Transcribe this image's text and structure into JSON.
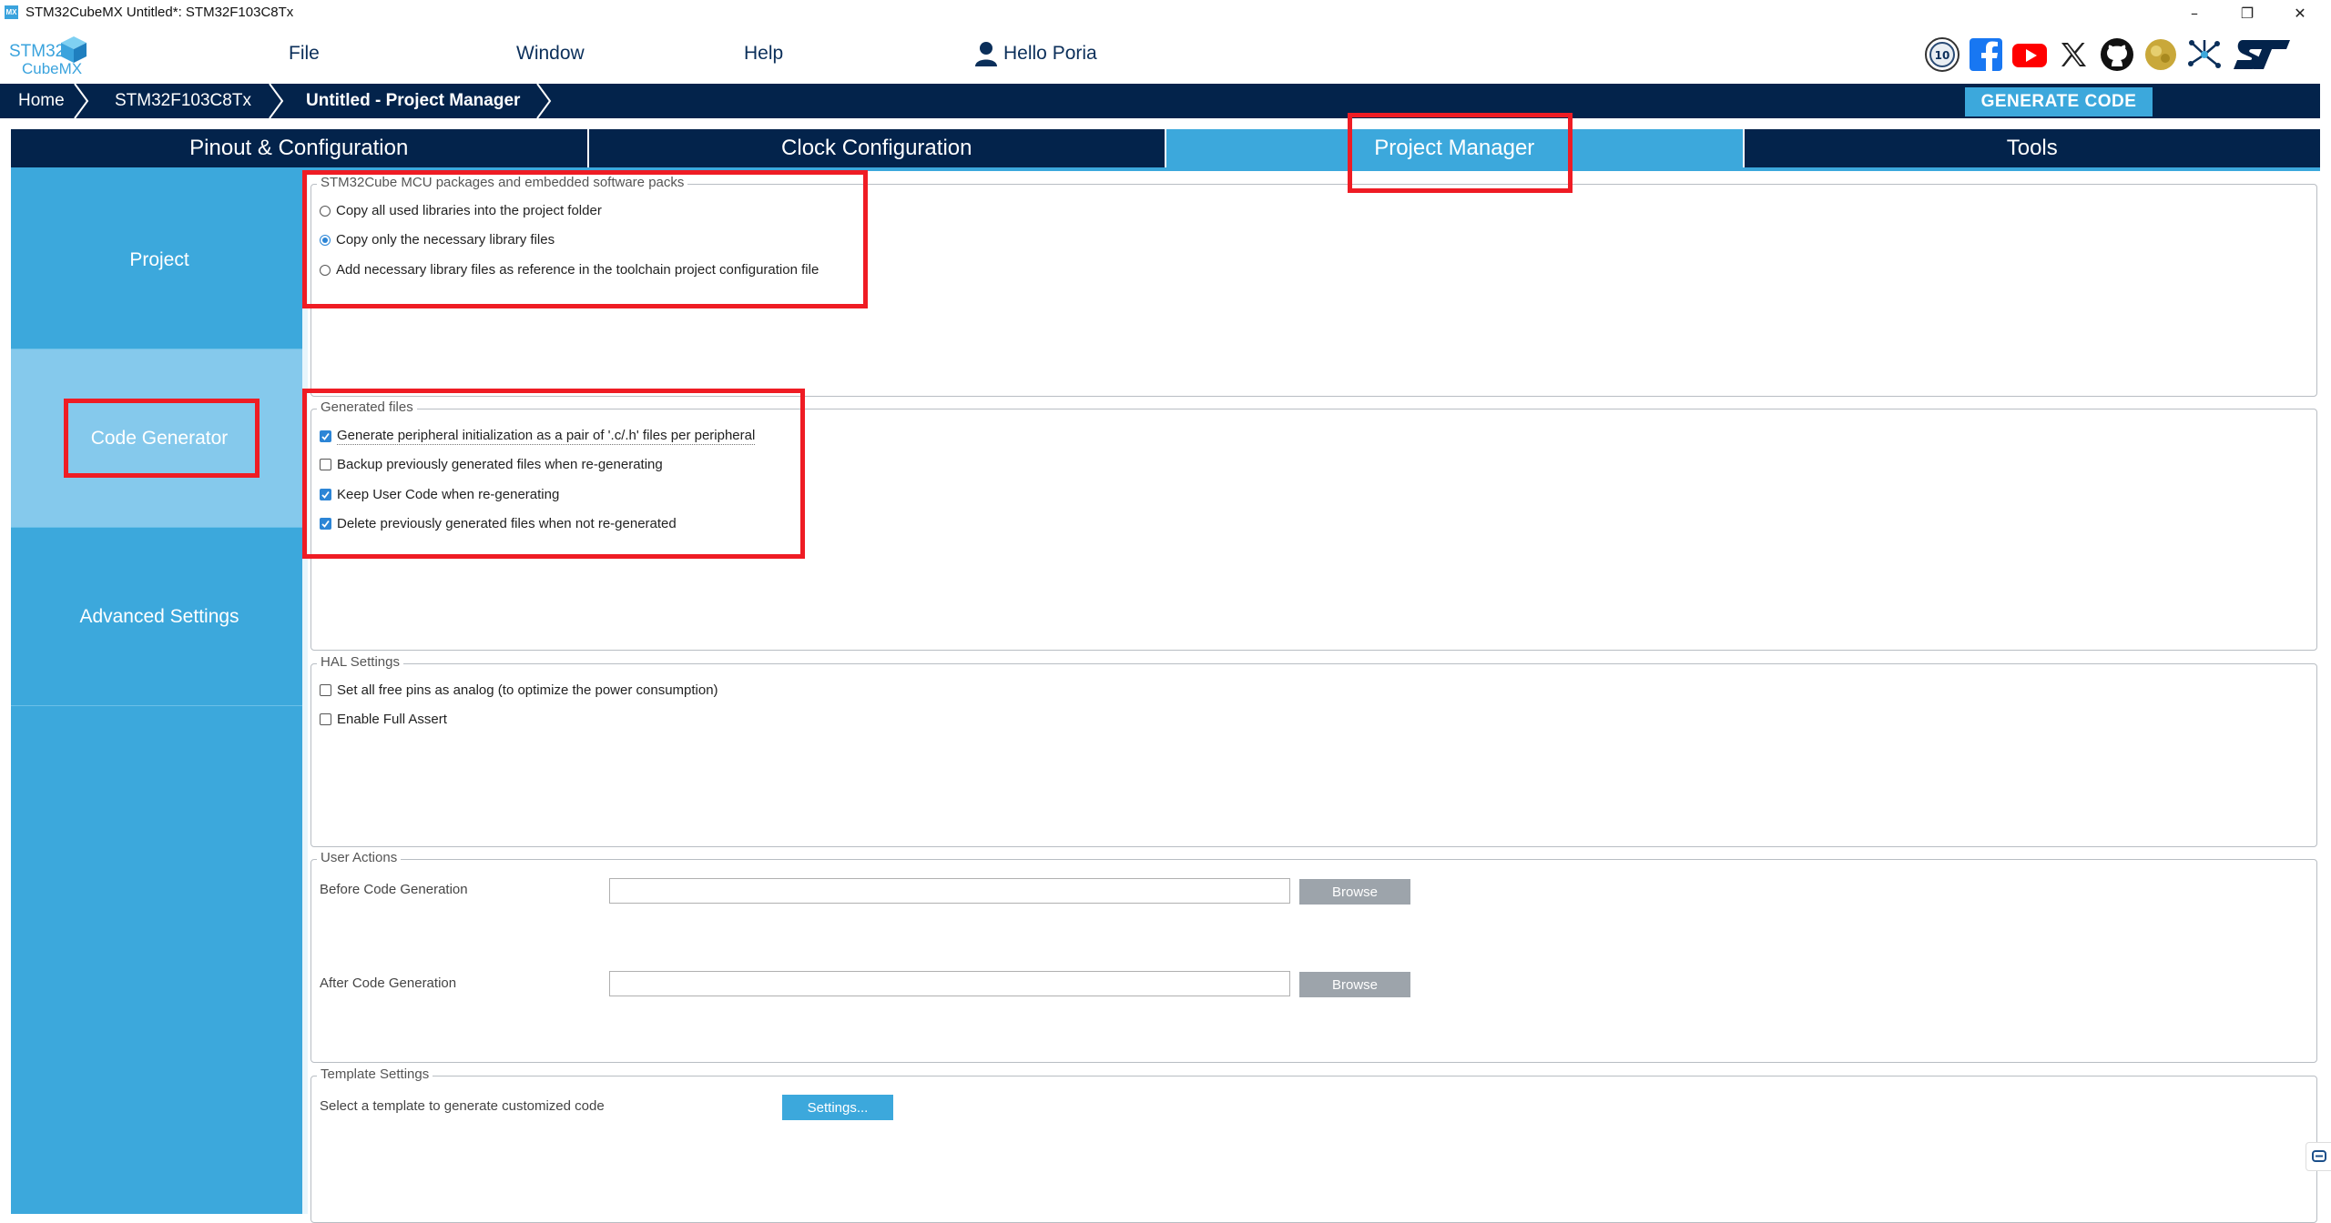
{
  "window": {
    "title": "STM32CubeMX Untitled*: STM32F103C8Tx",
    "app_icon": "MX",
    "minimize": "–",
    "maximize": "❐",
    "close": "✕"
  },
  "logo": {
    "line1": "STM32",
    "line2": "CubeMX"
  },
  "menu": {
    "file": "File",
    "window": "Window",
    "help": "Help",
    "user": "Hello Poria"
  },
  "social_icons": [
    "anniversary-10-icon",
    "facebook-icon",
    "youtube-icon",
    "x-icon",
    "github-icon",
    "community-icon",
    "network-icon",
    "st-logo-icon"
  ],
  "breadcrumb": {
    "home": "Home",
    "device": "STM32F103C8Tx",
    "current": "Untitled - Project Manager"
  },
  "generate_button": "GENERATE CODE",
  "tabs": [
    {
      "label": "Pinout & Configuration",
      "active": false
    },
    {
      "label": "Clock Configuration",
      "active": false
    },
    {
      "label": "Project Manager",
      "active": true
    },
    {
      "label": "Tools",
      "active": false
    }
  ],
  "nav": {
    "project": "Project",
    "code_generator": "Code Generator",
    "advanced": "Advanced Settings",
    "selected": "Code Generator"
  },
  "packages": {
    "title": "STM32Cube MCU packages and embedded software packs",
    "options": [
      {
        "label": "Copy all used libraries into the project folder",
        "selected": false
      },
      {
        "label": "Copy only the necessary library files",
        "selected": true
      },
      {
        "label": "Add necessary library files as reference in the toolchain project configuration file",
        "selected": false
      }
    ]
  },
  "generated_files": {
    "title": "Generated files",
    "options": [
      {
        "label": "Generate peripheral initialization as a pair of '.c/.h' files per peripheral",
        "checked": true
      },
      {
        "label": "Backup previously generated files when re-generating",
        "checked": false
      },
      {
        "label": "Keep User Code when re-generating",
        "checked": true
      },
      {
        "label": "Delete previously generated files when not re-generated",
        "checked": true
      }
    ]
  },
  "hal": {
    "title": "HAL Settings",
    "options": [
      {
        "label": "Set all free pins as analog (to optimize the power consumption)",
        "checked": false
      },
      {
        "label": "Enable Full Assert",
        "checked": false
      }
    ]
  },
  "user_actions": {
    "title": "User Actions",
    "before_label": "Before Code Generation",
    "before_value": "",
    "after_label": "After Code Generation",
    "after_value": "",
    "browse": "Browse"
  },
  "template": {
    "title": "Template Settings",
    "label": "Select a template to generate customized code",
    "button": "Settings..."
  },
  "colors": {
    "navy": "#03234b",
    "accent": "#3ca8dc",
    "nav_selected": "#85c9ec",
    "annotation": "#ef1c24"
  }
}
